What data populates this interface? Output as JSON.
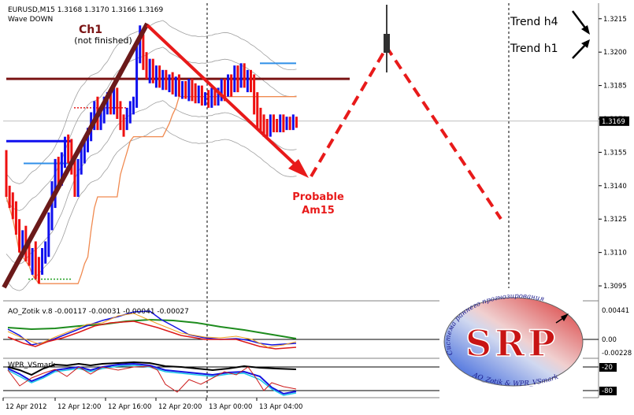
{
  "header": {
    "quote": "EURUSD,M15  1.3168 1.3170 1.3166 1.3169",
    "indicator": "Wave DOWN"
  },
  "annotations": {
    "ch1": "Ch1",
    "ch1_note": "(not finished)",
    "probable_line1": "Probable",
    "probable_line2": "Am15",
    "trend_h4": "Trend h4",
    "trend_h1": "Trend h1"
  },
  "logo": {
    "letters": "SRP",
    "arc_text_top": "Система раннего прогнозирования",
    "arc_text_bottom": "AO_Zotik & WPR_VSmark"
  },
  "panels": {
    "ao": {
      "label": "AO_Zotik v.8 -0.00117 -0.00031 -0.00041 -0.00027",
      "scale": [
        "0.00441",
        "0.00",
        "-0.00228"
      ]
    },
    "wpr": {
      "label": "WPR_VSmark",
      "scale": [
        "-20",
        "-80"
      ]
    }
  },
  "chart_data": {
    "type": "bar",
    "symbol": "EURUSD",
    "timeframe": "M15",
    "current_price": 1.3169,
    "current_price_label": "1.3169",
    "ylim": [
      1.3089,
      1.3222
    ],
    "y_ticks": [
      "1.3215",
      "1.3200",
      "1.3185",
      "1.3170",
      "1.3155",
      "1.3140",
      "1.3125",
      "1.3110",
      "1.3095"
    ],
    "x_ticks": [
      "12 Apr 2012",
      "12 Apr 12:00",
      "12 Apr 16:00",
      "12 Apr 20:00",
      "13 Apr 00:00",
      "13 Apr 04:00"
    ],
    "grid": "vertical-dashed",
    "series": [
      {
        "x": [
          0,
          1,
          2,
          3,
          4,
          5,
          6,
          7,
          8,
          9,
          10,
          11,
          12,
          13,
          14,
          15,
          16,
          17,
          18,
          19,
          20,
          21,
          22,
          23,
          24,
          25,
          26,
          27,
          28,
          29,
          30,
          31,
          32,
          33,
          34,
          35,
          36,
          37,
          38,
          39,
          40,
          41,
          42,
          43,
          44,
          45,
          46,
          47,
          48,
          49,
          50,
          51,
          52,
          53,
          54,
          55,
          56,
          57,
          58,
          59,
          60,
          61,
          62,
          63,
          64,
          65,
          66,
          67,
          68,
          69,
          70,
          71,
          72,
          73,
          74,
          75,
          76,
          77,
          78,
          79,
          80,
          81,
          82,
          83,
          84,
          85,
          86,
          87,
          88,
          89
        ],
        "open": [
          1.3154,
          1.3138,
          1.3135,
          1.313,
          1.3122,
          1.3115,
          1.312,
          1.3112,
          1.3108,
          1.3112,
          1.3105,
          1.31,
          1.311,
          1.3112,
          1.3125,
          1.314,
          1.315,
          1.3145,
          1.3152,
          1.316,
          1.3158,
          1.315,
          1.314,
          1.315,
          1.3155,
          1.316,
          1.3163,
          1.317,
          1.3175,
          1.317,
          1.3172,
          1.3178,
          1.318,
          1.3176,
          1.3182,
          1.3175,
          1.317,
          1.3168,
          1.3172,
          1.3176,
          1.3178,
          1.32,
          1.3205,
          1.3198,
          1.3192,
          1.3195,
          1.319,
          1.3192,
          1.3188,
          1.319,
          1.3186,
          1.3189,
          1.3185,
          1.3188,
          1.3183,
          1.3185,
          1.3182,
          1.3186,
          1.3184,
          1.3181,
          1.3183,
          1.318,
          1.3181,
          1.3178,
          1.3182,
          1.318,
          1.3182,
          1.3186,
          1.3184,
          1.3188,
          1.3186,
          1.319,
          1.3187,
          1.3192,
          1.3188,
          1.319,
          1.3185,
          1.318,
          1.3173,
          1.317,
          1.3168,
          1.3166,
          1.317,
          1.3168,
          1.3166,
          1.317,
          1.3167,
          1.3169,
          1.3166,
          1.317
        ],
        "high": [
          1.3156,
          1.314,
          1.3137,
          1.3133,
          1.3125,
          1.312,
          1.3122,
          1.3115,
          1.3112,
          1.3115,
          1.3108,
          1.3112,
          1.3115,
          1.3128,
          1.3142,
          1.3152,
          1.3153,
          1.3155,
          1.3162,
          1.3163,
          1.3161,
          1.3154,
          1.3152,
          1.3158,
          1.3162,
          1.3166,
          1.3173,
          1.3178,
          1.318,
          1.3175,
          1.318,
          1.3182,
          1.3184,
          1.3184,
          1.3184,
          1.3178,
          1.3172,
          1.3175,
          1.3178,
          1.318,
          1.3204,
          1.3212,
          1.3208,
          1.32,
          1.3197,
          1.3197,
          1.3194,
          1.3194,
          1.3192,
          1.3192,
          1.319,
          1.3191,
          1.3189,
          1.319,
          1.3187,
          1.3187,
          1.3188,
          1.3188,
          1.3186,
          1.3185,
          1.3185,
          1.3182,
          1.3183,
          1.3184,
          1.3184,
          1.3184,
          1.3188,
          1.3188,
          1.319,
          1.319,
          1.3194,
          1.3194,
          1.3195,
          1.3195,
          1.3192,
          1.3192,
          1.319,
          1.3182,
          1.3175,
          1.3172,
          1.317,
          1.3172,
          1.3172,
          1.317,
          1.3172,
          1.3172,
          1.3171,
          1.3171,
          1.3172,
          1.3171
        ],
        "low": [
          1.3135,
          1.313,
          1.3125,
          1.3118,
          1.311,
          1.3108,
          1.3106,
          1.3104,
          1.31,
          1.3098,
          1.3096,
          1.31,
          1.3105,
          1.3108,
          1.312,
          1.313,
          1.314,
          1.314,
          1.3148,
          1.315,
          1.3145,
          1.3135,
          1.3135,
          1.3145,
          1.315,
          1.3155,
          1.316,
          1.3165,
          1.3165,
          1.3165,
          1.3168,
          1.3172,
          1.3172,
          1.3172,
          1.317,
          1.3165,
          1.3162,
          1.3165,
          1.3168,
          1.3172,
          1.3175,
          1.3195,
          1.3192,
          1.3188,
          1.3186,
          1.3186,
          1.3184,
          1.3184,
          1.3183,
          1.3183,
          1.3182,
          1.3181,
          1.318,
          1.318,
          1.3179,
          1.3179,
          1.3178,
          1.3178,
          1.3177,
          1.3177,
          1.3176,
          1.3176,
          1.3175,
          1.3175,
          1.3176,
          1.3176,
          1.3178,
          1.3178,
          1.318,
          1.318,
          1.3182,
          1.3182,
          1.3184,
          1.3184,
          1.3182,
          1.3182,
          1.3172,
          1.3166,
          1.3164,
          1.3162,
          1.3162,
          1.3162,
          1.3164,
          1.3164,
          1.3164,
          1.3164,
          1.3165,
          1.3165,
          1.3165,
          1.3166
        ],
        "close": [
          1.3138,
          1.3135,
          1.313,
          1.3122,
          1.3115,
          1.312,
          1.3112,
          1.3108,
          1.3112,
          1.3105,
          1.31,
          1.311,
          1.3112,
          1.3125,
          1.314,
          1.315,
          1.3145,
          1.3152,
          1.316,
          1.3158,
          1.315,
          1.314,
          1.315,
          1.3155,
          1.316,
          1.3163,
          1.317,
          1.3175,
          1.317,
          1.3172,
          1.3178,
          1.318,
          1.3176,
          1.3182,
          1.3175,
          1.317,
          1.3168,
          1.3172,
          1.3176,
          1.3178,
          1.32,
          1.3205,
          1.3198,
          1.3192,
          1.3195,
          1.319,
          1.3192,
          1.3188,
          1.319,
          1.3186,
          1.3189,
          1.3185,
          1.3188,
          1.3183,
          1.3185,
          1.3182,
          1.3186,
          1.3184,
          1.3181,
          1.3183,
          1.318,
          1.3181,
          1.3178,
          1.3182,
          1.318,
          1.3182,
          1.3186,
          1.3184,
          1.3188,
          1.3186,
          1.319,
          1.3187,
          1.3192,
          1.3188,
          1.319,
          1.3185,
          1.318,
          1.3173,
          1.317,
          1.3168,
          1.3166,
          1.317,
          1.3168,
          1.3166,
          1.317,
          1.3167,
          1.3169,
          1.3166,
          1.317,
          1.3169
        ]
      }
    ],
    "levels": [
      {
        "kind": "horizontal",
        "price": 1.3188,
        "color": "#7a1414"
      },
      {
        "kind": "horizontal",
        "price": 1.3169,
        "color": "#999999"
      }
    ],
    "colors": {
      "up": "#1010ee",
      "down": "#ee1010",
      "projection": "#e81a1a",
      "channel": "#6b1a1a",
      "level": "#7a1414",
      "band": "#a0a0a0",
      "orange": "#f08a50"
    }
  }
}
